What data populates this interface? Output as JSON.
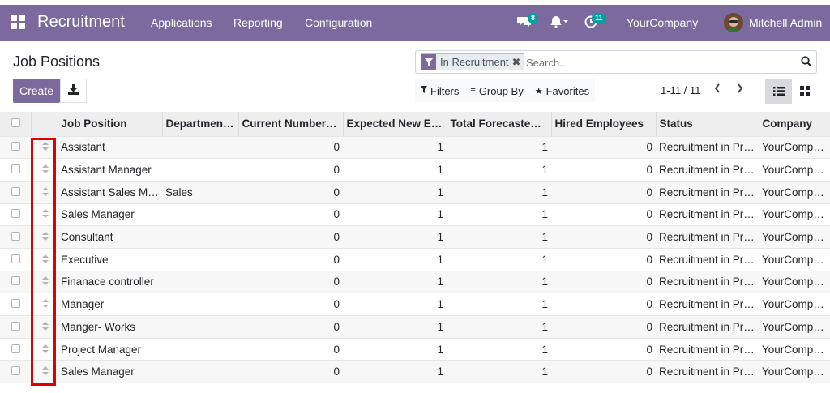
{
  "navbar": {
    "app_name": "Recruitment",
    "menus": [
      "Applications",
      "Reporting",
      "Configuration"
    ],
    "messages_badge": "8",
    "activity_badge": "11",
    "company": "YourCompany",
    "user": "Mitchell Admin",
    "bar_color": "#7c6a9f"
  },
  "control_panel": {
    "title": "Job Positions",
    "create_label": "Create",
    "search": {
      "facet_label": "In Recruitment",
      "placeholder": "Search..."
    },
    "filters_label": "Filters",
    "groupby_label": "Group By",
    "favorites_label": "Favorites",
    "pager": "1-11 / 11"
  },
  "table": {
    "headers": [
      "Job Position",
      "Departmen…",
      "Current Number …",
      "Expected New E…",
      "Total Forecasted …",
      "Hired Employees",
      "Status",
      "Company"
    ],
    "rows": [
      {
        "job": "Assistant",
        "dept": "",
        "current": "0",
        "expected": "1",
        "forecast": "1",
        "hired": "0",
        "status": "Recruitment in Pro…",
        "company": "YourCompany"
      },
      {
        "job": "Assistant Manager",
        "dept": "",
        "current": "0",
        "expected": "1",
        "forecast": "1",
        "hired": "0",
        "status": "Recruitment in Pro…",
        "company": "YourCompany"
      },
      {
        "job": "Assistant Sales M…",
        "dept": "Sales",
        "current": "0",
        "expected": "1",
        "forecast": "1",
        "hired": "0",
        "status": "Recruitment in Pro…",
        "company": "YourCompany"
      },
      {
        "job": "Sales Manager",
        "dept": "",
        "current": "0",
        "expected": "1",
        "forecast": "1",
        "hired": "0",
        "status": "Recruitment in Pro…",
        "company": "YourCompany"
      },
      {
        "job": "Consultant",
        "dept": "",
        "current": "0",
        "expected": "1",
        "forecast": "1",
        "hired": "0",
        "status": "Recruitment in Pro…",
        "company": "YourCompany"
      },
      {
        "job": "Executive",
        "dept": "",
        "current": "0",
        "expected": "1",
        "forecast": "1",
        "hired": "0",
        "status": "Recruitment in Pro…",
        "company": "YourCompany"
      },
      {
        "job": "Finanace controller",
        "dept": "",
        "current": "0",
        "expected": "1",
        "forecast": "1",
        "hired": "0",
        "status": "Recruitment in Pro…",
        "company": "YourCompany"
      },
      {
        "job": "Manager",
        "dept": "",
        "current": "0",
        "expected": "1",
        "forecast": "1",
        "hired": "0",
        "status": "Recruitment in Pro…",
        "company": "YourCompany"
      },
      {
        "job": "Manger- Works",
        "dept": "",
        "current": "0",
        "expected": "1",
        "forecast": "1",
        "hired": "0",
        "status": "Recruitment in Pro…",
        "company": "YourCompany"
      },
      {
        "job": "Project Manager",
        "dept": "",
        "current": "0",
        "expected": "1",
        "forecast": "1",
        "hired": "0",
        "status": "Recruitment in Pro…",
        "company": "YourCompany"
      },
      {
        "job": "Sales Manager",
        "dept": "",
        "current": "0",
        "expected": "1",
        "forecast": "1",
        "hired": "0",
        "status": "Recruitment in Pro…",
        "company": "YourCompany"
      }
    ]
  },
  "highlight_color": "#e00000"
}
